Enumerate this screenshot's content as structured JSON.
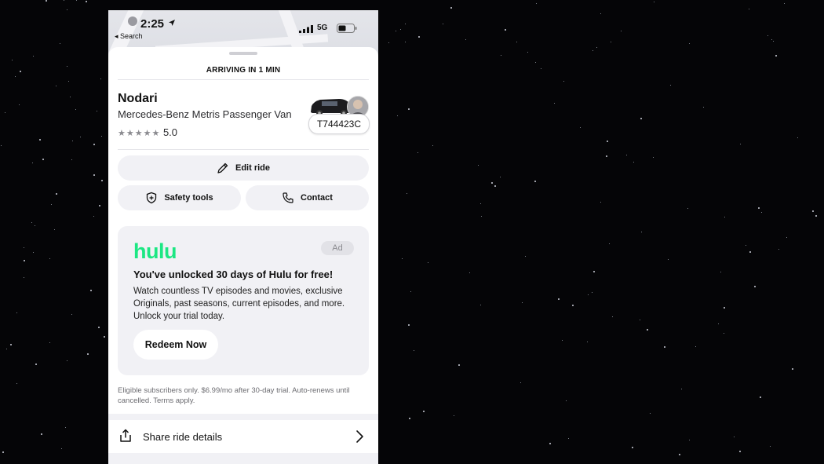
{
  "status_bar": {
    "time": "2:25",
    "back_label": "◂ Search",
    "network": "5G"
  },
  "sheet": {
    "arriving": "ARRIVING IN 1 MIN",
    "driver": {
      "name": "Nodari",
      "vehicle": "Mercedes-Benz Metris Passenger Van",
      "rating": "5.0",
      "plate": "T744423C"
    },
    "actions": {
      "edit_ride": "Edit ride",
      "safety_tools": "Safety tools",
      "contact": "Contact"
    },
    "ad": {
      "brand": "hulu",
      "badge": "Ad",
      "headline": "You've unlocked 30 days of Hulu for free!",
      "body": "Watch countless TV episodes and movies, exclusive Originals, past seasons, current episodes, and more. Unlock your trial today.",
      "cta": "Redeem Now",
      "disclaimer": "Eligible subscribers only. $6.99/mo after 30-day trial. Auto-renews until cancelled. Terms apply."
    },
    "share": {
      "label": "Share ride details"
    }
  },
  "colors": {
    "hulu_green": "#1ce783",
    "background": "#050507",
    "pill_bg": "#f1f1f5"
  }
}
